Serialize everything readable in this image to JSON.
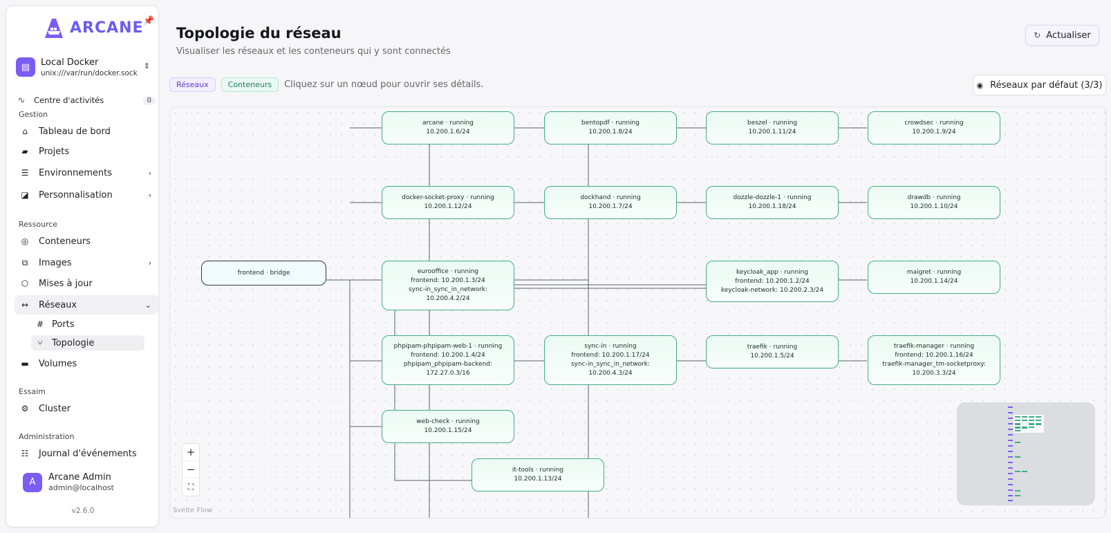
{
  "brand": {
    "name": "ARCANE"
  },
  "environment": {
    "name": "Local Docker",
    "socket": "unix:///var/run/docker.sock"
  },
  "activity": {
    "label": "Centre d'activités",
    "count": "0"
  },
  "sections": {
    "gestion": "Gestion",
    "ressource": "Ressource",
    "essaim": "Essaim",
    "administration": "Administration"
  },
  "nav": {
    "dashboard": "Tableau de bord",
    "projects": "Projets",
    "environments": "Environnements",
    "customization": "Personnalisation",
    "containers": "Conteneurs",
    "images": "Images",
    "updates": "Mises à jour",
    "networks": "Réseaux",
    "ports": "Ports",
    "topology": "Topologie",
    "volumes": "Volumes",
    "cluster": "Cluster",
    "events": "Journal d'événements"
  },
  "user": {
    "initial": "A",
    "name": "Arcane Admin",
    "email": "admin@localhost"
  },
  "version": "v2.6.0",
  "header": {
    "title": "Topologie du réseau",
    "subtitle": "Visualiser les réseaux et les conteneurs qui y sont connectés",
    "refresh": "Actualiser"
  },
  "legend": {
    "networks": "Réseaux",
    "containers": "Conteneurs",
    "hint": "Cliquez sur un nœud pour ouvrir ses détails."
  },
  "filter_button": "Réseaux par défaut (3/3)",
  "attribution": "Svelte Flow",
  "nodes": {
    "frontend": [
      "frontend · bridge"
    ],
    "arcane": [
      "arcane · running",
      "10.200.1.6/24"
    ],
    "bentopdf": [
      "bentopdf · running",
      "10.200.1.8/24"
    ],
    "beszel": [
      "beszel · running",
      "10.200.1.11/24"
    ],
    "crowdsec": [
      "crowdsec · running",
      "10.200.1.9/24"
    ],
    "dockersocketproxy": [
      "docker-socket-proxy · running",
      "10.200.1.12/24"
    ],
    "dockhand": [
      "dockhand · running",
      "10.200.1.7/24"
    ],
    "dozzle": [
      "dozzle-dozzle-1 · running",
      "10.200.1.18/24"
    ],
    "drawdb": [
      "drawdb · running",
      "10.200.1.10/24"
    ],
    "eurooffice": [
      "eurooffice · running",
      "frontend: 10.200.1.3/24",
      "sync-in_sync_in_network:",
      "10.200.4.2/24"
    ],
    "keycloak": [
      "keycloak_app · running",
      "frontend: 10.200.1.2/24",
      "keycloak-network: 10.200.2.3/24"
    ],
    "maigret": [
      "maigret · running",
      "10.200.1.14/24"
    ],
    "phpipam": [
      "phpipam-phpipam-web-1 · running",
      "frontend: 10.200.1.4/24",
      "phpipam_phpipam-backend:",
      "172.27.0.3/16"
    ],
    "syncin": [
      "sync-in · running",
      "frontend: 10.200.1.17/24",
      "sync-in_sync_in_network:",
      "10.200.4.3/24"
    ],
    "traefik": [
      "traefik · running",
      "10.200.1.5/24"
    ],
    "traefikmanager": [
      "traefik-manager · running",
      "frontend: 10.200.1.16/24",
      "traefik-manager_tm-socketproxy:",
      "10.200.3.3/24"
    ],
    "webcheck": [
      "web-check · running",
      "10.200.1.15/24"
    ],
    "ittools": [
      "it-tools · running",
      "10.200.1.13/24"
    ]
  },
  "colors": {
    "accent": "#7b5cf5",
    "container_border": "#3fae85",
    "network_border": "#2e3a40"
  },
  "icons": {
    "pin": "pin-icon",
    "refresh": "refresh-icon",
    "eye": "eye-icon",
    "zoom_in": "plus-icon",
    "zoom_out": "minus-icon",
    "fit": "fit-view-icon"
  }
}
